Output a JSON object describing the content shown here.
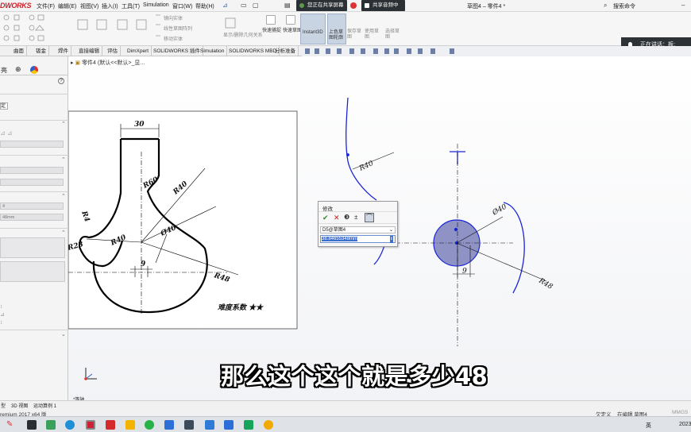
{
  "app": {
    "logo": "DWORKS",
    "version": "remium 2017 x64 版"
  },
  "menu": [
    "文件(F)",
    "编辑(E)",
    "视图(V)",
    "插入(I)",
    "工具(T)",
    "Simulation",
    "窗口(W)",
    "帮助(H)"
  ],
  "share": {
    "sharing": "您正在共享屏幕",
    "audio": "共享音频中"
  },
  "title": {
    "doc": "草图4 – 零件4 *",
    "search": "搜索命令",
    "speaking": "正在讲话：板;"
  },
  "ribbon": {
    "items": [
      "镜向实体",
      "线性草图阵列",
      "移动实体",
      "快速捕捉",
      "快速草图",
      "Instant3D",
      "上色草图轮廓"
    ],
    "faded": [
      "显示/删除几何关系",
      "修复草图",
      "保存草图",
      "使用草图",
      "选择草图"
    ]
  },
  "tabs": [
    "曲面",
    "钣金",
    "焊件",
    "直接编辑",
    "评估",
    "DimXpert",
    "SOLIDWORKS 插件",
    "Simulation",
    "SOLIDWORKS MBD",
    "分析准备"
  ],
  "breadcrumb": "零件4 (默认<<默认>_显...",
  "panel": {
    "label_definite": "定",
    "field1": "4",
    "field2": "48mm"
  },
  "drawing": {
    "dim30": "30",
    "r60": "R60",
    "r40a": "R40",
    "r4": "R4",
    "r23": "R23",
    "r40b": "R40",
    "phi40": "Ø40",
    "dim9": "9",
    "r48": "R48",
    "note": "难度系数 ★★"
  },
  "sketch": {
    "r40": "R40",
    "phi40": "Ø40",
    "dim9": "9",
    "r48": "R48",
    "view": "*等轴"
  },
  "modify_dialog": {
    "title": "修改",
    "dim_name": "D5@草图4",
    "value": "38.84655348mm"
  },
  "bottom_tabs": [
    "型",
    "3D 视图",
    "运动算例 1"
  ],
  "status": {
    "defined": "欠定义",
    "editing": "在编辑 草图4",
    "units": "MMGS"
  },
  "taskbar": {
    "ime": "英",
    "year": "2023"
  },
  "subtitle": "那么这个这个就是多少48",
  "colors": {
    "sketch_blue": "#1a25d6",
    "fill": "#8f92c4",
    "accent": "#d0202a"
  }
}
